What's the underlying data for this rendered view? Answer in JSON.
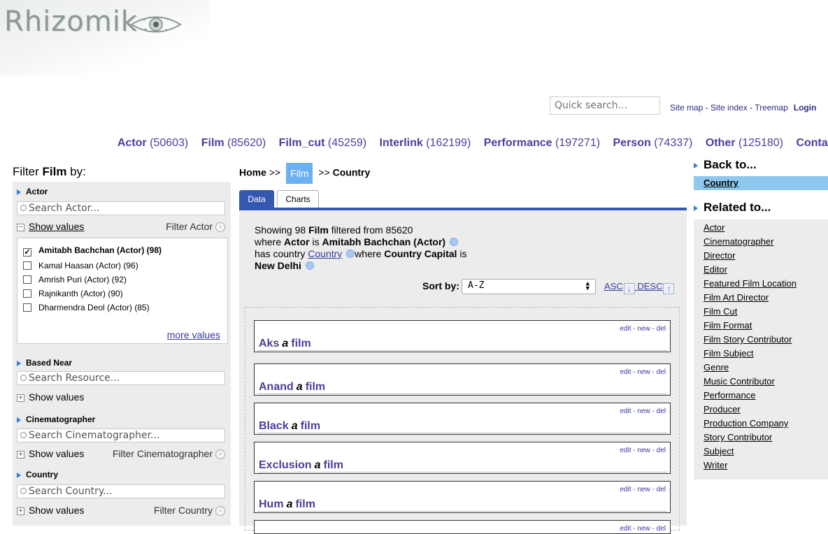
{
  "logo": {
    "text": "Rhizomik"
  },
  "quick_search": {
    "placeholder": "Quick search..."
  },
  "top_links": {
    "site_map": "Site map",
    "site_index": "Site index",
    "treemap": "Treemap",
    "login": "Login",
    "sep": " - "
  },
  "nav": [
    {
      "label": "Actor",
      "count": "(50603)"
    },
    {
      "label": "Film",
      "count": "(85620)"
    },
    {
      "label": "Film_cut",
      "count": "(45259)"
    },
    {
      "label": "Interlink",
      "count": "(162199)"
    },
    {
      "label": "Performance",
      "count": "(197271)"
    },
    {
      "label": "Person",
      "count": "(74337)"
    },
    {
      "label": "Other",
      "count": "(125180)"
    },
    {
      "label": "Contact",
      "count": ""
    }
  ],
  "filter": {
    "prefix": "Filter ",
    "class": "Film",
    "suffix": " by:"
  },
  "facets": {
    "actor": {
      "title": "Actor",
      "search": "Search Actor...",
      "show": "Show values",
      "filter": "Filter Actor",
      "values": [
        {
          "label": "Amitabh Bachchan (Actor) (98)",
          "checked": true
        },
        {
          "label": "Kamal Haasan (Actor) (96)",
          "checked": false
        },
        {
          "label": "Amrish Puri (Actor) (92)",
          "checked": false
        },
        {
          "label": "Rajnikanth (Actor) (90)",
          "checked": false
        },
        {
          "label": "Dharmendra Deol (Actor) (85)",
          "checked": false
        }
      ],
      "more": "more values"
    },
    "based_near": {
      "title": "Based Near",
      "search": "Search Resource...",
      "show": "Show values"
    },
    "cinematographer": {
      "title": "Cinematographer",
      "search": "Search Cinematographer...",
      "show": "Show values",
      "filter": "Filter Cinematographer"
    },
    "country": {
      "title": "Country",
      "search": "Search Country...",
      "show": "Show values",
      "filter": "Filter Country"
    }
  },
  "breadcrumb": {
    "home": "Home",
    "sep": ">>",
    "film": "Film",
    "country": "Country"
  },
  "tabs": {
    "data": "Data",
    "charts": "Charts"
  },
  "summary": {
    "l1a": "Showing 98 ",
    "l1b": "Film",
    "l1c": " filtered from 85620",
    "l2a": "where ",
    "l2b": "Actor",
    "l2c": " is ",
    "l2d": "Amitabh Bachchan (Actor)",
    "l3a": "has country ",
    "l3b": "Country",
    "l3c": "where ",
    "l3d": "Country Capital",
    "l3e": " is",
    "l4": "New Delhi"
  },
  "sort": {
    "label": "Sort by:",
    "value": "A-Z",
    "asc": "ASC",
    "desc": "DESC"
  },
  "results": [
    {
      "title": "Aks",
      "type": "a",
      "kind": "film"
    },
    {
      "title": "Anand",
      "type": "a",
      "kind": "film"
    },
    {
      "title": "Black",
      "type": "a",
      "kind": "film"
    },
    {
      "title": "Exclusion",
      "type": "a",
      "kind": "film"
    },
    {
      "title": "Hum",
      "type": "a",
      "kind": "film"
    }
  ],
  "card_tools": {
    "edit": "edit",
    "new": "new",
    "del": "del",
    "sep": " - "
  },
  "right": {
    "back_to": "Back to...",
    "country": "Country",
    "related_to": "Related to...",
    "related": [
      "Actor",
      "Cinematographer",
      "Director",
      "Editor",
      "Featured Film Location",
      "Film Art Director",
      "Film Cut",
      "Film Format",
      "Film Story Contributor",
      "Film Subject",
      "Genre",
      "Music Contributor",
      "Performance",
      "Producer",
      "Production Company",
      "Story Contributor",
      "Subject",
      "Writer"
    ]
  },
  "colors": {
    "nav": "#4a3f9a",
    "tab": "#3458b0",
    "crumb_film": "#6ab0f3",
    "country_box": "#8ec8ee"
  }
}
